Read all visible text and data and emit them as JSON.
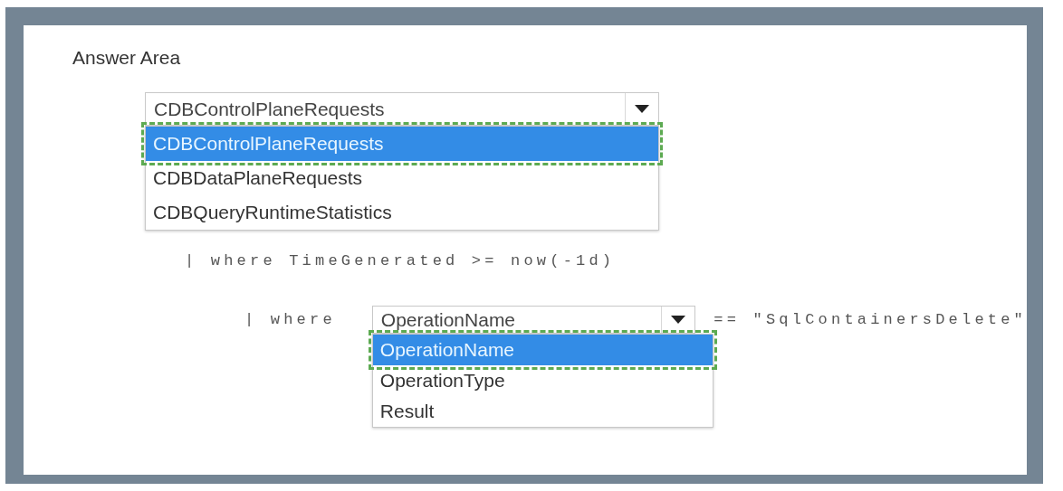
{
  "heading": "Answer Area",
  "lines": [
    {
      "kind": "dropdown",
      "value": "CDBControlPlaneRequests",
      "expanded": true,
      "options": [
        {
          "label": "CDBControlPlaneRequests",
          "selected": true,
          "correct": true
        },
        {
          "label": "CDBDataPlaneRequests",
          "selected": false,
          "correct": false
        },
        {
          "label": "CDBQueryRuntimeStatistics",
          "selected": false,
          "correct": false
        }
      ]
    },
    {
      "kind": "code",
      "text": "| where TimeGenerated >= now(-1d)"
    },
    {
      "kind": "mixed",
      "prefix": "| where",
      "suffix": "== \"SqlContainersDelete\"",
      "dropdown": {
        "value": "OperationName",
        "expanded": true,
        "options": [
          {
            "label": "OperationName",
            "selected": true,
            "correct": true
          },
          {
            "label": "OperationType",
            "selected": false,
            "correct": false
          },
          {
            "label": "Result",
            "selected": false,
            "correct": false
          }
        ]
      }
    }
  ]
}
